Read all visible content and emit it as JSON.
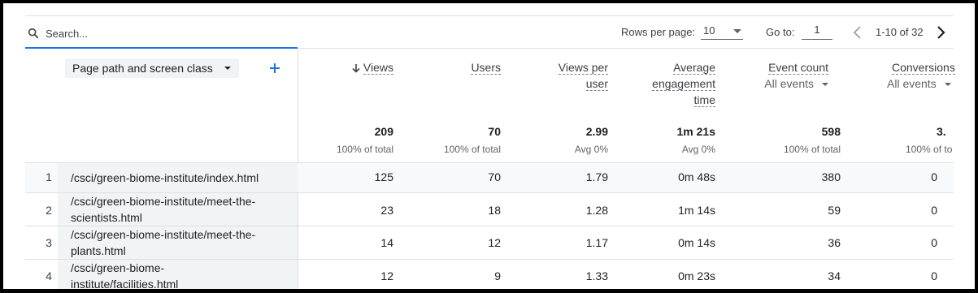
{
  "toolbar": {
    "search_placeholder": "Search...",
    "rows_per_page_label": "Rows per page:",
    "rows_per_page_value": "10",
    "goto_label": "Go to:",
    "goto_value": "1",
    "pagination_range": "1-10 of 32"
  },
  "dimension": {
    "label": "Page path and screen class"
  },
  "columns": [
    {
      "title": "Views",
      "title_line2": "",
      "title_line3": "",
      "sub": "",
      "total": "209",
      "total_sub": "100% of total"
    },
    {
      "title": "Users",
      "title_line2": "",
      "title_line3": "",
      "sub": "",
      "total": "70",
      "total_sub": "100% of total"
    },
    {
      "title": "Views per",
      "title_line2": "user",
      "title_line3": "",
      "sub": "",
      "total": "2.99",
      "total_sub": "Avg 0%"
    },
    {
      "title": "Average",
      "title_line2": "engagement",
      "title_line3": "time",
      "sub": "",
      "total": "1m 21s",
      "total_sub": "Avg 0%"
    },
    {
      "title": "Event count",
      "title_line2": "",
      "title_line3": "",
      "sub": "All events",
      "total": "598",
      "total_sub": "100% of total"
    },
    {
      "title": "Conversions",
      "title_line2": "",
      "title_line3": "",
      "sub": "All events",
      "total": "3.",
      "total_sub": "100% of to"
    }
  ],
  "rows": [
    {
      "num": "1",
      "path_line1": "/csci/green-biome-institute/index.html",
      "path_line2": "",
      "cells": [
        "125",
        "70",
        "1.79",
        "0m 48s",
        "380",
        "0"
      ]
    },
    {
      "num": "2",
      "path_line1": "/csci/green-biome-institute/meet-the-",
      "path_line2": "scientists.html",
      "cells": [
        "23",
        "18",
        "1.28",
        "1m 14s",
        "59",
        "0"
      ]
    },
    {
      "num": "3",
      "path_line1": "/csci/green-biome-institute/meet-the-",
      "path_line2": "plants.html",
      "cells": [
        "14",
        "12",
        "1.17",
        "0m 14s",
        "36",
        "0"
      ]
    },
    {
      "num": "4",
      "path_line1": "/csci/green-biome-",
      "path_line2": "institute/facilities.html",
      "cells": [
        "12",
        "9",
        "1.33",
        "0m 23s",
        "34",
        "0"
      ]
    }
  ],
  "icons": {
    "search": "search-icon",
    "sort": "arrow-down-icon",
    "add": "plus-icon",
    "prev": "chevron-left-icon",
    "next": "chevron-right-icon",
    "dropdown": "caret-down-icon"
  },
  "colors": {
    "accent": "#1a73e8",
    "header_bg": "#f1f3f4",
    "row_bg": "#f8f9fa",
    "border": "#e0e0e0"
  }
}
